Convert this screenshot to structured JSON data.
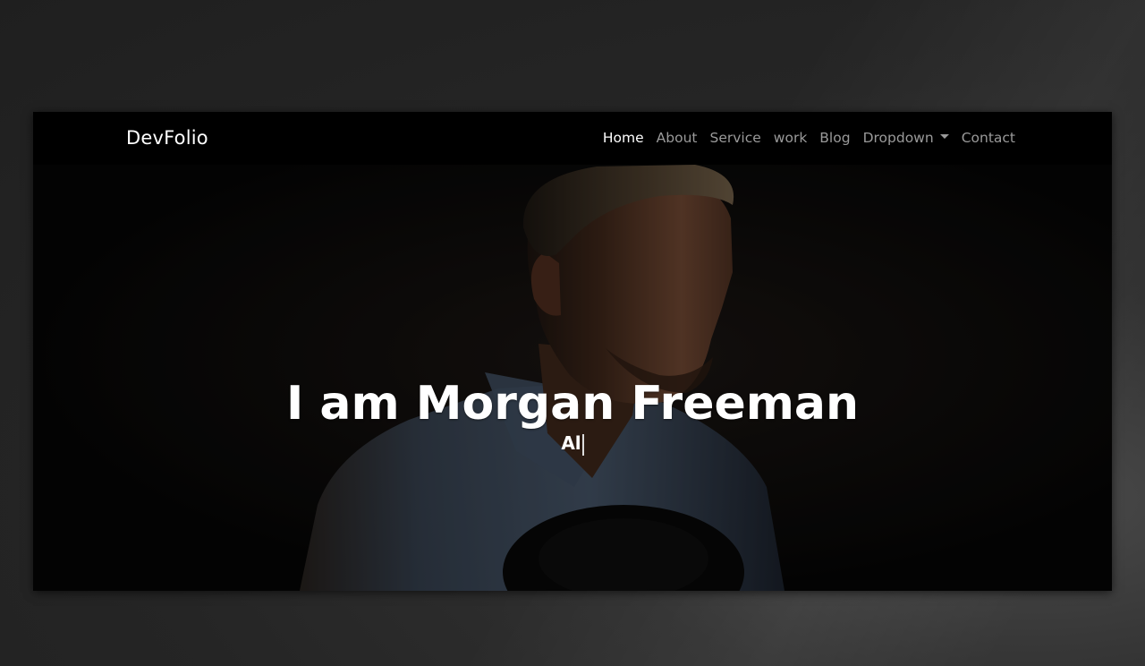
{
  "navbar": {
    "brand": "DevFolio",
    "links": [
      {
        "label": "Home",
        "active": true
      },
      {
        "label": "About"
      },
      {
        "label": "Service"
      },
      {
        "label": "work"
      },
      {
        "label": "Blog"
      },
      {
        "label": "Dropdown",
        "has_caret": true
      },
      {
        "label": "Contact"
      }
    ]
  },
  "hero": {
    "title": "I am Morgan Freeman",
    "typed_text": "Al"
  },
  "colors": {
    "nav_background": "#000000",
    "active_link": "#ffffff",
    "inactive_link": "#9a9a9a",
    "hero_text": "#ffffff"
  }
}
